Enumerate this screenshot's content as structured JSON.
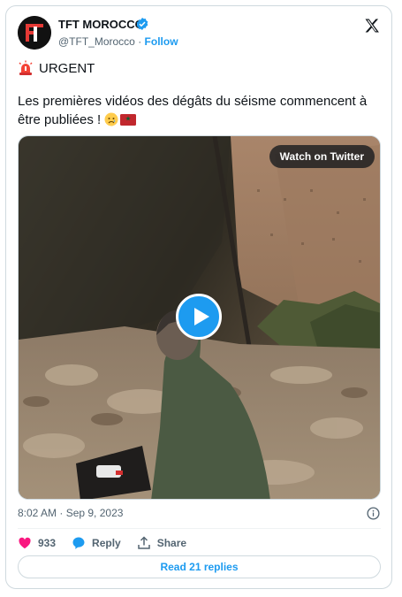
{
  "account": {
    "name": "TFT MOROCCO",
    "handle": "@TFT_Morocco",
    "separator": "·",
    "follow_label": "Follow"
  },
  "tweet": {
    "urgent_label": "URGENT",
    "text": "Les premières vidéos des dégâts du séisme commencent à être publiées !",
    "timestamp": "8:02 AM · Sep 9, 2023"
  },
  "media": {
    "watch_label": "Watch on Twitter"
  },
  "actions": {
    "likes_count": "933",
    "reply_label": "Reply",
    "share_label": "Share"
  },
  "read_replies_label": "Read 21 replies",
  "colors": {
    "accent": "#1d9bf0",
    "like": "#f91880",
    "text": "#0f1419",
    "muted": "#536471"
  },
  "icons": [
    "avatar-logo",
    "verified-badge-icon",
    "x-logo-icon",
    "siren-icon",
    "sad-face-emoji",
    "morocco-flag-emoji",
    "play-icon",
    "info-icon",
    "heart-icon",
    "reply-icon",
    "share-icon"
  ]
}
